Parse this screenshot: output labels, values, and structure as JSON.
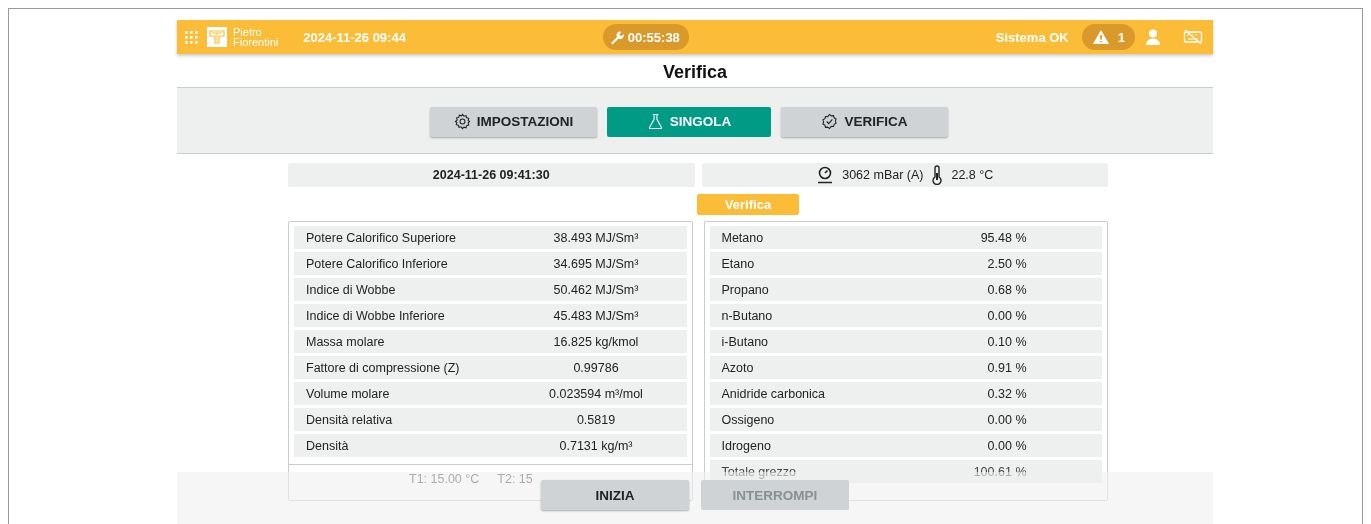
{
  "header": {
    "brand": [
      "Pietro",
      "Fiorentini"
    ],
    "datetime": "2024-11-26 09:44",
    "timer": "00:55:38",
    "status": "Sistema OK",
    "alarm_count": "1"
  },
  "page_title": "Verifica",
  "tabs": [
    {
      "label": "IMPOSTAZIONI",
      "selected": false
    },
    {
      "label": "SINGOLA",
      "selected": true
    },
    {
      "label": "VERIFICA",
      "selected": false
    }
  ],
  "info": {
    "timestamp": "2024-11-26 09:41:30",
    "pressure": "3062 mBar (A)",
    "temperature": "22.8 °C"
  },
  "mode_badge": "Verifica",
  "properties": [
    {
      "label": "Potere Calorifico Superiore",
      "value": "38.493 MJ/Sm³"
    },
    {
      "label": "Potere Calorifico Inferiore",
      "value": "34.695 MJ/Sm³"
    },
    {
      "label": "Indice di Wobbe",
      "value": "50.462 MJ/Sm³"
    },
    {
      "label": "Indice di Wobbe Inferiore",
      "value": "45.483 MJ/Sm³"
    },
    {
      "label": "Massa molare",
      "value": "16.825 kg/kmol"
    },
    {
      "label": "Fattore di compressione (Z)",
      "value": "0.99786"
    },
    {
      "label": "Volume molare",
      "value": "0.023594 m³/mol"
    },
    {
      "label": "Densità relativa",
      "value": "0.5819"
    },
    {
      "label": "Densità",
      "value": "0.7131 kg/m³"
    }
  ],
  "properties_footer": [
    "T1: 15.00 °C",
    "T2: 15"
  ],
  "components": [
    {
      "label": "Metano",
      "value": "95.48 %"
    },
    {
      "label": "Etano",
      "value": "2.50 %"
    },
    {
      "label": "Propano",
      "value": "0.68 %"
    },
    {
      "label": "n-Butano",
      "value": "0.00 %"
    },
    {
      "label": "i-Butano",
      "value": "0.10 %"
    },
    {
      "label": "Azoto",
      "value": "0.91 %"
    },
    {
      "label": "Anidride carbonica",
      "value": "0.32 %"
    },
    {
      "label": "Ossigeno",
      "value": "0.00 %"
    },
    {
      "label": "Idrogeno",
      "value": "0.00 %"
    }
  ],
  "components_footer": {
    "label": "Totale grezzo",
    "value": "100.61 %"
  },
  "actions": [
    {
      "label": "INIZIA",
      "disabled": false
    },
    {
      "label": "INTERROMPI",
      "disabled": true
    }
  ]
}
